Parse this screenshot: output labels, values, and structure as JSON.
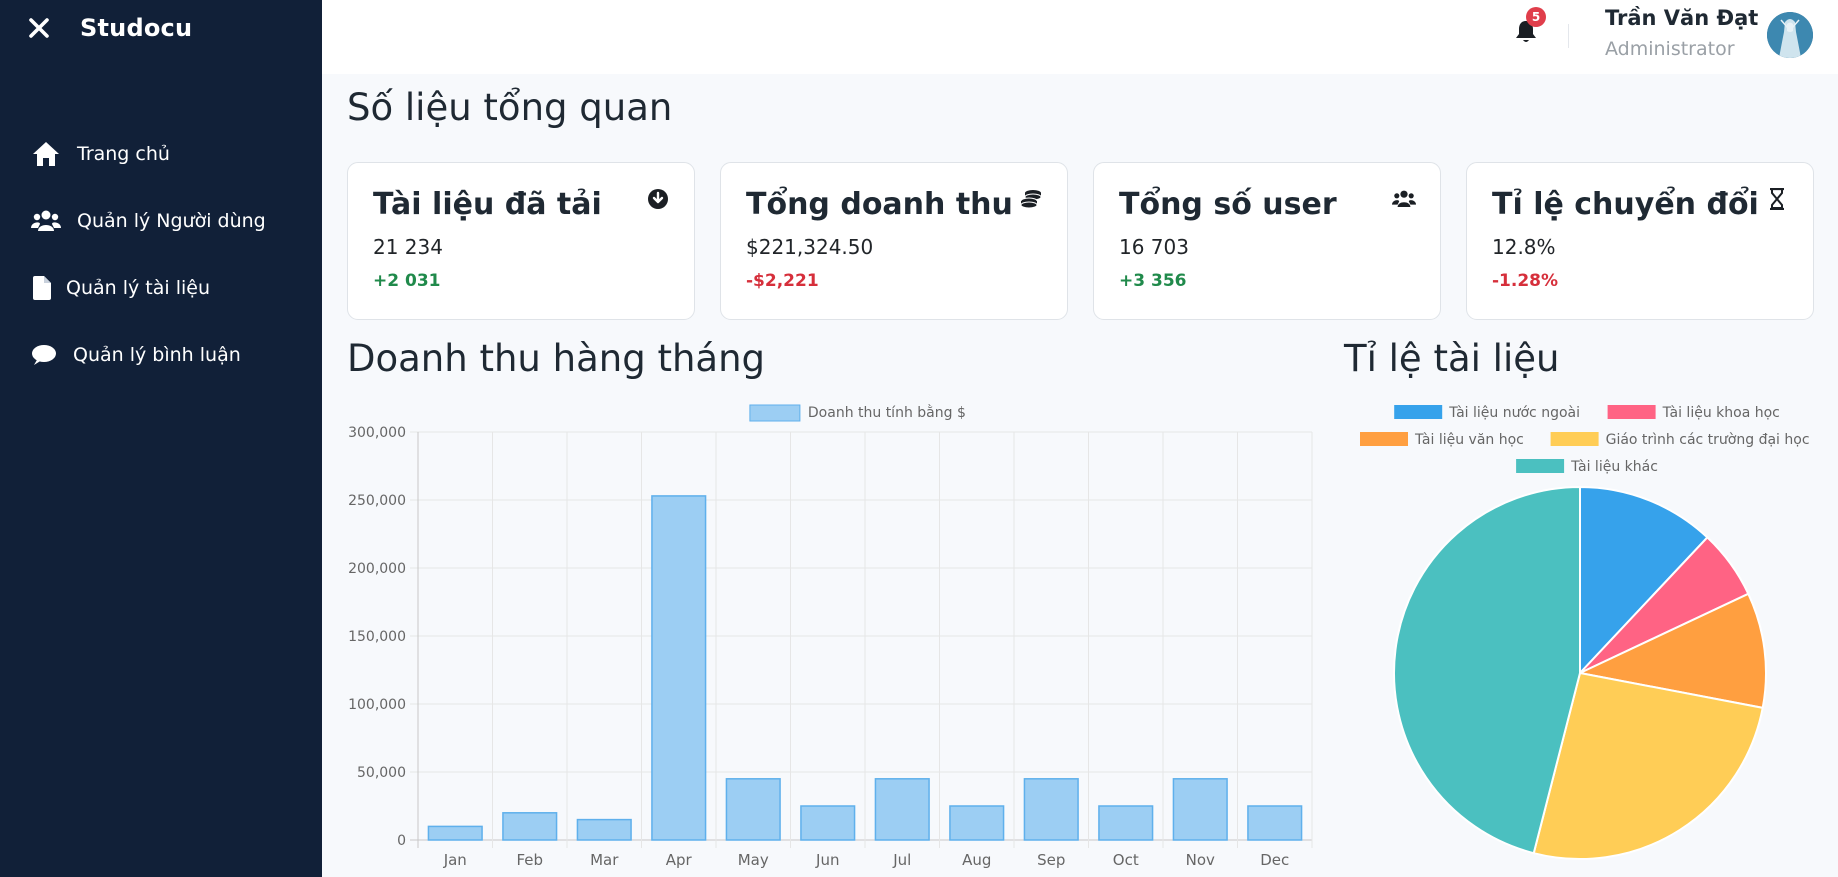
{
  "sidebar": {
    "brand": "Studocu",
    "items": [
      {
        "label": "Trang chủ",
        "icon": "home-icon"
      },
      {
        "label": "Quản lý Người dùng",
        "icon": "users-icon"
      },
      {
        "label": "Quản lý tài liệu",
        "icon": "file-icon"
      },
      {
        "label": "Quản lý bình luận",
        "icon": "comment-icon"
      }
    ]
  },
  "header": {
    "notification_count": "5",
    "user_name": "Trần Văn Đạt",
    "user_role": "Administrator"
  },
  "overview": {
    "title": "Số liệu tổng quan",
    "cards": [
      {
        "title": "Tài liệu đã tải",
        "value": "21 234",
        "change": "+2 031",
        "trend": "up",
        "icon": "download-icon"
      },
      {
        "title": "Tổng doanh thu",
        "value": "$221,324.50",
        "change": "-$2,221",
        "trend": "down",
        "icon": "coins-icon"
      },
      {
        "title": "Tổng số user",
        "value": "16 703",
        "change": "+3 356",
        "trend": "up",
        "icon": "users-icon"
      },
      {
        "title": "Tỉ lệ chuyển đổi",
        "value": "12.8%",
        "change": "-1.28%",
        "trend": "down",
        "icon": "hourglass-icon"
      }
    ]
  },
  "revenue": {
    "title": "Doanh thu hàng tháng"
  },
  "docs": {
    "title": "Tỉ lệ tài liệu"
  },
  "colors": {
    "sidebar": "#112038",
    "bar_fill": "#9ccef3",
    "bar_stroke": "#5fb0ec",
    "up": "#208a4b",
    "down": "#d62f3b"
  },
  "chart_data": [
    {
      "type": "bar",
      "categories": [
        "Jan",
        "Feb",
        "Mar",
        "Apr",
        "May",
        "Jun",
        "Jul",
        "Aug",
        "Sep",
        "Oct",
        "Nov",
        "Dec"
      ],
      "series": [
        {
          "name": "Doanh thu tính bằng $",
          "values": [
            10000,
            20000,
            15000,
            253000,
            45000,
            25000,
            45000,
            25000,
            45000,
            25000,
            45000,
            25000
          ]
        }
      ],
      "ylim": [
        0,
        300000
      ],
      "yticks": [
        "0",
        "50,000",
        "100,000",
        "150,000",
        "200,000",
        "250,000",
        "300,000"
      ],
      "grid": true,
      "legend": "top-center"
    },
    {
      "type": "pie",
      "categories": [
        "Tài liệu nước ngoài",
        "Tài liệu khoa học",
        "Tài liệu văn học",
        "Giáo trình các trường đại học",
        "Tài liệu khác"
      ],
      "values": [
        12,
        6,
        10,
        26,
        46
      ],
      "colors": [
        "#36a2eb",
        "#ff6384",
        "#ff9f40",
        "#ffcd56",
        "#4bc0c0"
      ],
      "legend": "top"
    }
  ]
}
